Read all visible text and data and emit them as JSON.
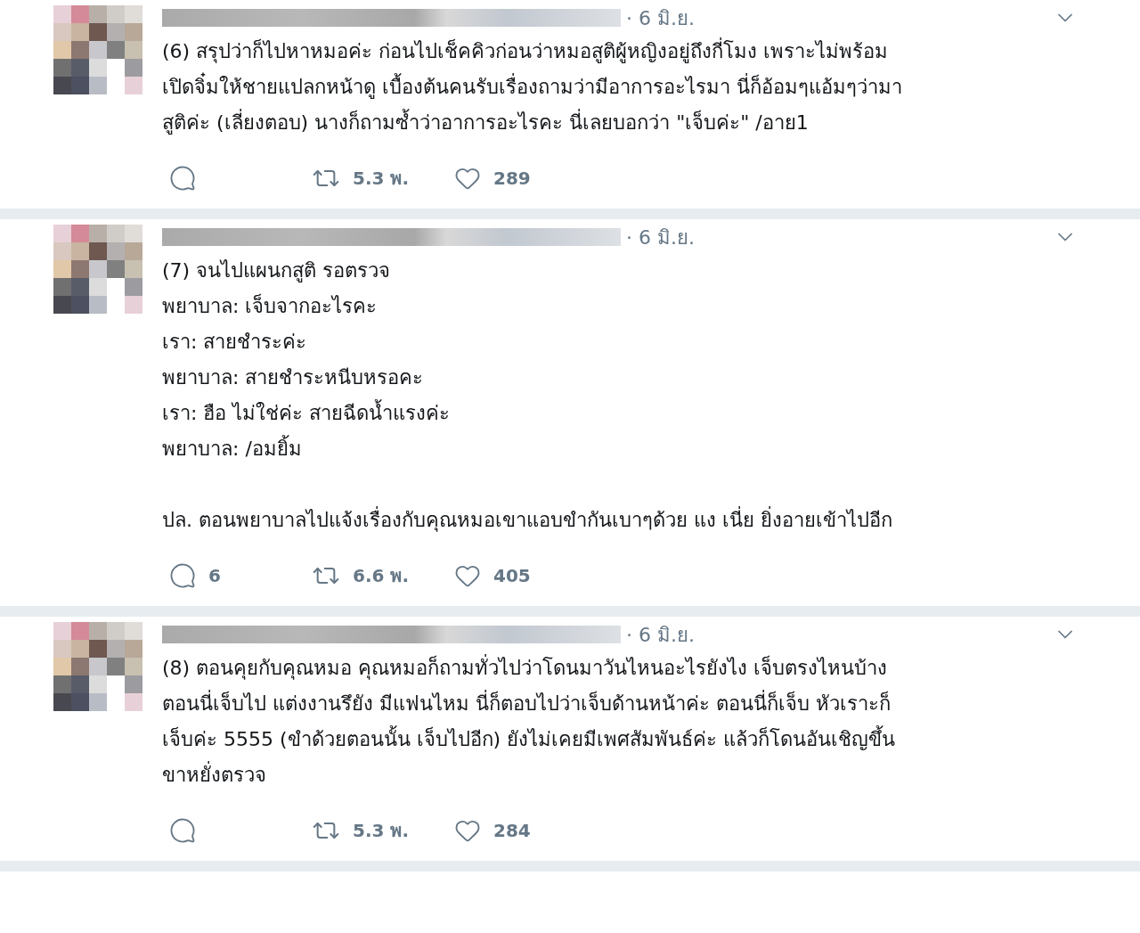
{
  "tweets": [
    {
      "time": "· 6 มิ.ย.",
      "text": "(6) สรุปว่าก็ไปหาหมอค่ะ ก่อนไปเช็คคิวก่อนว่าหมอสูติผู้หญิงอยู่ถึงกี่โมง เพราะไม่พร้อม\nเปิดจิ๋มให้ชายแปลกหน้าดู เบื้องต้นคนรับเรื่องถามว่ามีอาการอะไรมา นี่ก็อ้อมๆแอ้มๆว่ามา\nสูติค่ะ (เลี่ยงตอบ) นางก็ถามซ้ำว่าอาการอะไรคะ นี่เลยบอกว่า \"เจ็บค่ะ\" /อาย1",
      "retweets": "5.3 พ.",
      "likes": "289"
    },
    {
      "time": "· 6 มิ.ย.",
      "text": "(7) จนไปแผนกสูติ รอตรวจ\nพยาบาล: เจ็บจากอะไรคะ\nเรา: สายชำระค่ะ\nพยาบาล: สายชำระหนีบหรอคะ\nเรา: ฮือ ไม่ใช่ค่ะ สายฉีดน้ำแรงค่ะ\nพยาบาล: /อมยิ้ม\n\nปล. ตอนพยาบาลไปแจ้งเรื่องกับคุณหมอเขาแอบขำกันเบาๆด้วย แง เนี่ย ยิ่งอายเข้าไปอีก",
      "replies": "6",
      "retweets": "6.6 พ.",
      "likes": "405"
    },
    {
      "time": "· 6 มิ.ย.",
      "text": "(8) ตอนคุยกับคุณหมอ คุณหมอก็ถามทั่วไปว่าโดนมาวันไหนอะไรยังไง เจ็บตรงไหนบ้าง\nตอนนี่เจ็บไป แต่งงานรึยัง มีแฟนไหม นี่ก็ตอบไปว่าเจ็บด้านหน้าค่ะ ตอนนี่ก็เจ็บ หัวเราะก็\nเจ็บค่ะ 5555 (ขำด้วยตอนนั้น เจ็บไปอีก) ยังไม่เคยมีเพศสัมพันธ์ค่ะ แล้วก็โดนอันเชิญขึ้น\nขาหยั่งตรวจ",
      "retweets": "5.3 พ.",
      "likes": "284"
    }
  ]
}
